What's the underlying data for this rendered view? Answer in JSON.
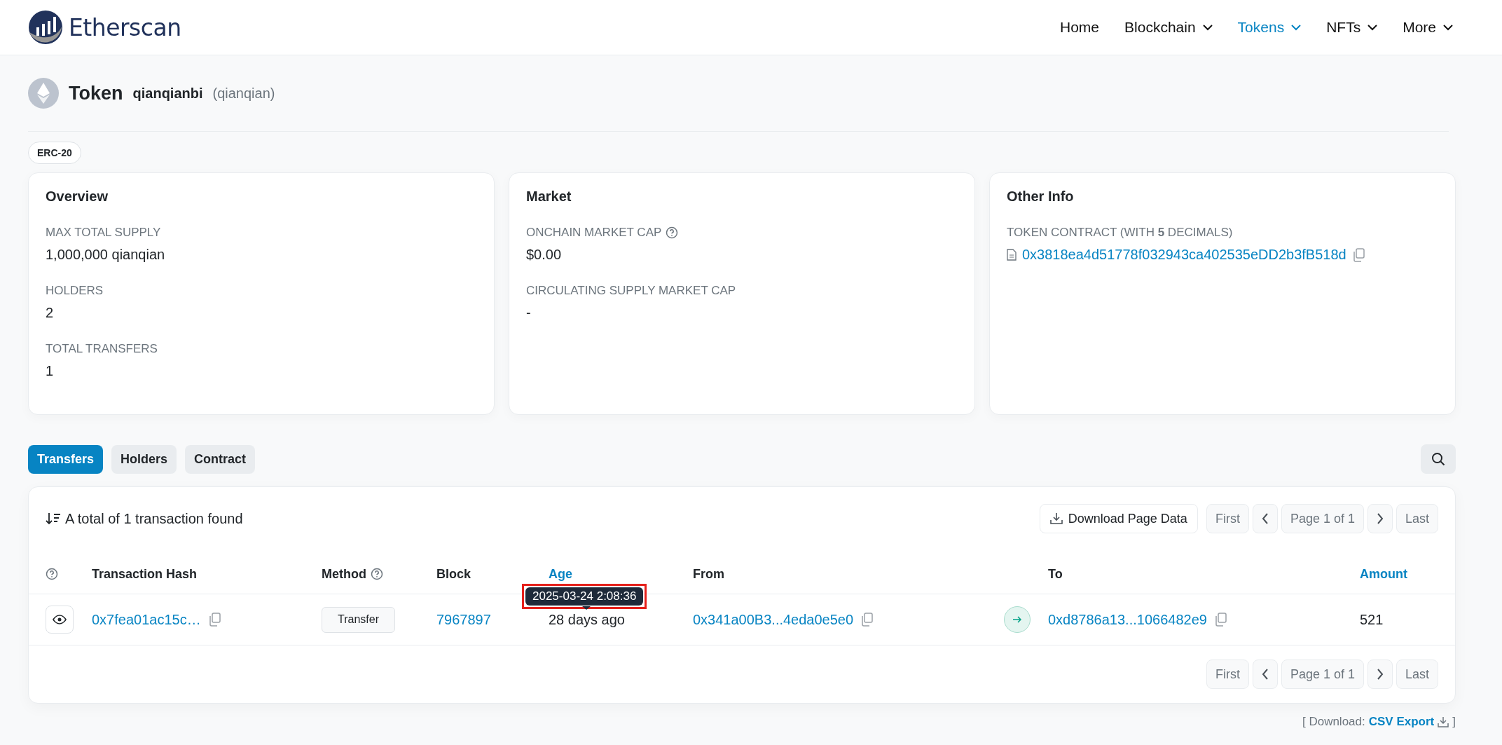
{
  "header": {
    "logo": "Etherscan",
    "nav": [
      {
        "label": "Home",
        "selected": false,
        "dropdown": false
      },
      {
        "label": "Blockchain",
        "selected": false,
        "dropdown": true
      },
      {
        "label": "Tokens",
        "selected": true,
        "dropdown": true
      },
      {
        "label": "NFTs",
        "selected": false,
        "dropdown": true
      },
      {
        "label": "More",
        "selected": false,
        "dropdown": true
      }
    ]
  },
  "token": {
    "title": "Token",
    "name": "qianqianbi",
    "symbol": "(qianqian)",
    "standard": "ERC-20"
  },
  "cards": [
    {
      "title": "Overview",
      "items": [
        {
          "label": "MAX TOTAL SUPPLY",
          "value": "1,000,000 qianqian",
          "kind": "plain"
        },
        {
          "label": "HOLDERS",
          "value": "2",
          "kind": "plain"
        },
        {
          "label": "TOTAL TRANSFERS",
          "value": "1",
          "kind": "plain"
        }
      ]
    },
    {
      "title": "Market",
      "items": [
        {
          "label": "ONCHAIN MARKET CAP",
          "help": true,
          "value": "$0.00",
          "kind": "plain"
        },
        {
          "label": "CIRCULATING SUPPLY MARKET CAP",
          "value": "-",
          "kind": "plain"
        }
      ]
    },
    {
      "title": "Other Info",
      "items": [
        {
          "label": "TOKEN CONTRACT (WITH **5** DECIMALS)",
          "value": "0x3818ea4d51778f032943ca402535eDD2b3fB518d",
          "kind": "contract"
        }
      ]
    }
  ],
  "tabs": [
    {
      "label": "Transfers",
      "selected": true
    },
    {
      "label": "Holders",
      "selected": false
    },
    {
      "label": "Contract",
      "selected": false
    }
  ],
  "transfers": {
    "summary": "A total of 1 transaction found",
    "download": "Download Page Data",
    "pager_top": {
      "first": "First",
      "page": "Page 1 of 1",
      "last": "Last"
    },
    "pager_bottom": {
      "first": "First",
      "page": "Page 1 of 1",
      "last": "Last"
    },
    "columns": [
      {
        "kind": "help"
      },
      {
        "kind": "text",
        "label": "Transaction Hash"
      },
      {
        "kind": "text",
        "label": "Method",
        "help": true
      },
      {
        "kind": "text",
        "label": "Block"
      },
      {
        "kind": "link",
        "label": "Age"
      },
      {
        "kind": "text",
        "label": "From"
      },
      {
        "kind": "blank"
      },
      {
        "kind": "text",
        "label": "To"
      },
      {
        "kind": "link",
        "label": "Amount"
      }
    ],
    "rows": [
      {
        "hash": "0x7fea01ac15c…",
        "method": "Transfer",
        "block": "7967897",
        "age": "28 days ago",
        "from": "0x341a00B3...4eda0e5e0",
        "to": "0xd8786a13...1066482e9",
        "amount": "521"
      }
    ],
    "tooltip": {
      "text": "2025-03-24 2:08:36",
      "highlighted": true
    }
  },
  "footer": {
    "prefix": "[ Download:",
    "link": "CSV Export",
    "suffix": "]"
  }
}
